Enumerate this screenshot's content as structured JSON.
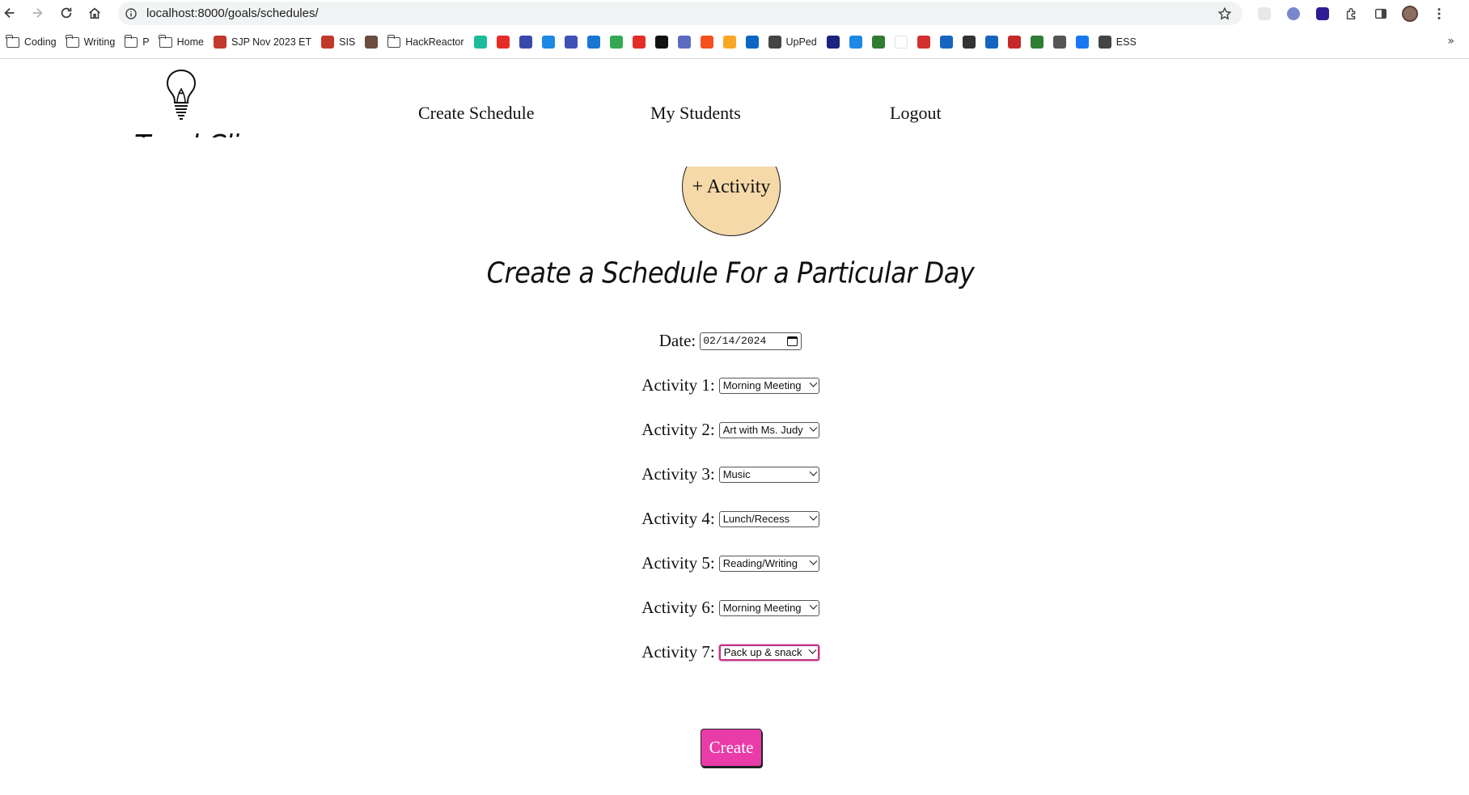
{
  "browser": {
    "url": "localhost:8000/goals/schedules/",
    "bookmarks": [
      {
        "kind": "folder",
        "label": "Coding"
      },
      {
        "kind": "folder",
        "label": "Writing"
      },
      {
        "kind": "folder",
        "label": "P"
      },
      {
        "kind": "folder",
        "label": "Home"
      },
      {
        "kind": "site",
        "label": "SJP Nov 2023 ET",
        "color": "#c0392b"
      },
      {
        "kind": "site",
        "label": "SIS",
        "color": "#c0392b"
      },
      {
        "kind": "site",
        "label": "",
        "color": "#6d4c41"
      },
      {
        "kind": "folder",
        "label": "HackReactor"
      },
      {
        "kind": "site",
        "label": "",
        "color": "#1abc9c"
      },
      {
        "kind": "site",
        "label": "",
        "color": "#e52d27"
      },
      {
        "kind": "site",
        "label": "",
        "color": "#3949ab"
      },
      {
        "kind": "site",
        "label": "",
        "color": "#1e88e5"
      },
      {
        "kind": "site",
        "label": "",
        "color": "#3f51b5"
      },
      {
        "kind": "site",
        "label": "",
        "color": "#1976d2"
      },
      {
        "kind": "site",
        "label": "",
        "color": "#34a853"
      },
      {
        "kind": "site",
        "label": "",
        "color": "#e52d27"
      },
      {
        "kind": "site",
        "label": "",
        "color": "#111111"
      },
      {
        "kind": "site",
        "label": "",
        "color": "#5c6bc0"
      },
      {
        "kind": "site",
        "label": "",
        "color": "#f4511e"
      },
      {
        "kind": "site",
        "label": "",
        "color": "#f9a825"
      },
      {
        "kind": "site",
        "label": "",
        "color": "#0a66c2"
      },
      {
        "kind": "site",
        "label": "UpPed",
        "color": "#444444"
      },
      {
        "kind": "site",
        "label": "",
        "color": "#1a237e"
      },
      {
        "kind": "site",
        "label": "",
        "color": "#1e88e5"
      },
      {
        "kind": "site",
        "label": "",
        "color": "#2e7d32"
      },
      {
        "kind": "site",
        "label": "",
        "color": "#ffffff"
      },
      {
        "kind": "site",
        "label": "",
        "color": "#d32f2f"
      },
      {
        "kind": "site",
        "label": "",
        "color": "#1565c0"
      },
      {
        "kind": "site",
        "label": "",
        "color": "#333333"
      },
      {
        "kind": "site",
        "label": "",
        "color": "#1565c0"
      },
      {
        "kind": "site",
        "label": "",
        "color": "#c62828"
      },
      {
        "kind": "site",
        "label": "",
        "color": "#2e7d32"
      },
      {
        "kind": "site",
        "label": "",
        "color": "#555555"
      },
      {
        "kind": "site",
        "label": "",
        "color": "#1877f2"
      },
      {
        "kind": "site",
        "label": "ESS",
        "color": "#444444"
      }
    ],
    "more_glyph": "»"
  },
  "app": {
    "logo_text": "TeachClip",
    "nav": {
      "create_schedule": "Create Schedule",
      "my_students": "My Students",
      "logout": "Logout"
    },
    "add_activity_label": "+ Activity",
    "title": "Create a Schedule For a Particular Day",
    "date_label": "Date:",
    "date_value": "02/14/2024",
    "activities": [
      {
        "label": "Activity 1:",
        "value": "Morning Meeting"
      },
      {
        "label": "Activity 2:",
        "value": "Art with Ms. Judy"
      },
      {
        "label": "Activity 3:",
        "value": "Music"
      },
      {
        "label": "Activity 4:",
        "value": "Lunch/Recess"
      },
      {
        "label": "Activity 5:",
        "value": "Reading/Writing"
      },
      {
        "label": "Activity 6:",
        "value": "Morning Meeting"
      },
      {
        "label": "Activity 7:",
        "value": "Pack up & snack"
      }
    ],
    "create_label": "Create",
    "colors": {
      "activity_circle": "#f5d9a8",
      "create_button": "#ea3ca9",
      "focus_ring": "#c13584"
    }
  }
}
